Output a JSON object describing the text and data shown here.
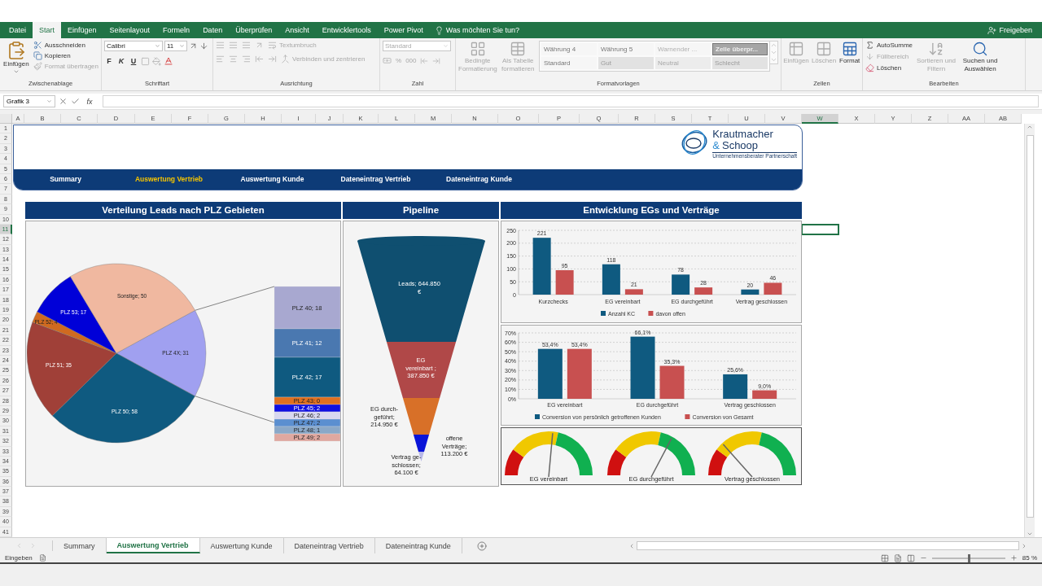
{
  "ribbon_tabs": [
    {
      "label": "Datei",
      "selected": false
    },
    {
      "label": "Start",
      "selected": true
    },
    {
      "label": "Einfügen",
      "selected": false
    },
    {
      "label": "Seitenlayout",
      "selected": false
    },
    {
      "label": "Formeln",
      "selected": false
    },
    {
      "label": "Daten",
      "selected": false
    },
    {
      "label": "Überprüfen",
      "selected": false
    },
    {
      "label": "Ansicht",
      "selected": false
    },
    {
      "label": "Entwicklertools",
      "selected": false
    },
    {
      "label": "Power Pivot",
      "selected": false
    }
  ],
  "tell_me": {
    "placeholder": "Was möchten Sie tun?"
  },
  "share": "Freigeben",
  "clipboard": {
    "title": "Zwischenablage",
    "paste": "Einfügen",
    "items": [
      {
        "label": "Ausschneiden",
        "disabled": false
      },
      {
        "label": "Kopieren",
        "disabled": false
      },
      {
        "label": "Format übertragen",
        "disabled": true
      }
    ]
  },
  "font": {
    "title": "Schriftart",
    "family": "Calibri",
    "size": "11",
    "bold": "F",
    "italic": "K",
    "underline": "U"
  },
  "alignment": {
    "title": "Ausrichtung",
    "wrap": "Textumbruch",
    "merge": "Verbinden und zentrieren"
  },
  "number": {
    "title": "Zahl",
    "format": "Standard",
    "percent": "%",
    "thousands": "000"
  },
  "styles": {
    "title": "Formatvorlagen",
    "conditional": "Bedingte Formatierung",
    "as_table": "Als Tabelle formatieren",
    "cells": [
      {
        "label": "Währung 4",
        "kind": "plain"
      },
      {
        "label": "Währung 5",
        "kind": "plain"
      },
      {
        "label": "Warnender ...",
        "kind": "warning"
      },
      {
        "label": "Zelle überpr...",
        "kind": "check"
      },
      {
        "label": "Standard",
        "kind": "plain"
      },
      {
        "label": "Gut",
        "kind": "good"
      },
      {
        "label": "Neutral",
        "kind": "neutral"
      },
      {
        "label": "Schlecht",
        "kind": "bad"
      }
    ]
  },
  "cells_group": {
    "title": "Zellen",
    "items": [
      {
        "label": "Einfügen",
        "disabled": true
      },
      {
        "label": "Löschen",
        "disabled": true
      },
      {
        "label": "Format",
        "disabled": false
      }
    ]
  },
  "editing": {
    "title": "Bearbeiten",
    "items": [
      {
        "label": "AutoSumme",
        "disabled": false
      },
      {
        "label": "Füllbereich",
        "disabled": true
      },
      {
        "label": "Löschen",
        "disabled": false
      }
    ],
    "sort": {
      "label": "Sortieren und Filtern",
      "disabled": true
    },
    "find": {
      "label": "Suchen und Auswählen",
      "disabled": false
    }
  },
  "formula_bar": {
    "name_box": "Grafik 3",
    "function_label": "fx"
  },
  "columns": [
    {
      "label": "A",
      "selected": false
    },
    {
      "label": "B",
      "selected": false
    },
    {
      "label": "C",
      "selected": false
    },
    {
      "label": "D",
      "selected": false
    },
    {
      "label": "E",
      "selected": false
    },
    {
      "label": "F",
      "selected": false
    },
    {
      "label": "G",
      "selected": false
    },
    {
      "label": "H",
      "selected": false
    },
    {
      "label": "I",
      "selected": false
    },
    {
      "label": "J",
      "selected": false
    },
    {
      "label": "K",
      "selected": false
    },
    {
      "label": "L",
      "selected": false
    },
    {
      "label": "M",
      "selected": false
    },
    {
      "label": "N",
      "selected": false
    },
    {
      "label": "O",
      "selected": false
    },
    {
      "label": "P",
      "selected": false
    },
    {
      "label": "Q",
      "selected": false
    },
    {
      "label": "R",
      "selected": false
    },
    {
      "label": "S",
      "selected": false
    },
    {
      "label": "T",
      "selected": false
    },
    {
      "label": "U",
      "selected": false
    },
    {
      "label": "V",
      "selected": false
    },
    {
      "label": "W",
      "selected": true
    },
    {
      "label": "X",
      "selected": false
    },
    {
      "label": "Y",
      "selected": false
    },
    {
      "label": "Z",
      "selected": false
    },
    {
      "label": "AA",
      "selected": false
    },
    {
      "label": "AB",
      "selected": false
    }
  ],
  "rows": [
    {
      "label": "1",
      "selected": false
    },
    {
      "label": "2",
      "selected": false
    },
    {
      "label": "3",
      "selected": false
    },
    {
      "label": "4",
      "selected": false
    },
    {
      "label": "5",
      "selected": false
    },
    {
      "label": "6",
      "selected": false
    },
    {
      "label": "7",
      "selected": false
    },
    {
      "label": "8",
      "selected": false
    },
    {
      "label": "9",
      "selected": false
    },
    {
      "label": "10",
      "selected": false
    },
    {
      "label": "11",
      "selected": true
    },
    {
      "label": "12",
      "selected": false
    },
    {
      "label": "13",
      "selected": false
    },
    {
      "label": "14",
      "selected": false
    },
    {
      "label": "15",
      "selected": false
    },
    {
      "label": "16",
      "selected": false
    },
    {
      "label": "17",
      "selected": false
    },
    {
      "label": "18",
      "selected": false
    },
    {
      "label": "19",
      "selected": false
    },
    {
      "label": "20",
      "selected": false
    },
    {
      "label": "21",
      "selected": false
    },
    {
      "label": "22",
      "selected": false
    },
    {
      "label": "23",
      "selected": false
    },
    {
      "label": "24",
      "selected": false
    },
    {
      "label": "25",
      "selected": false
    },
    {
      "label": "26",
      "selected": false
    },
    {
      "label": "27",
      "selected": false
    },
    {
      "label": "28",
      "selected": false
    },
    {
      "label": "29",
      "selected": false
    },
    {
      "label": "30",
      "selected": false
    },
    {
      "label": "31",
      "selected": false
    },
    {
      "label": "32",
      "selected": false
    },
    {
      "label": "33",
      "selected": false
    },
    {
      "label": "34",
      "selected": false
    },
    {
      "label": "35",
      "selected": false
    },
    {
      "label": "36",
      "selected": false
    },
    {
      "label": "37",
      "selected": false
    },
    {
      "label": "38",
      "selected": false
    },
    {
      "label": "39",
      "selected": false
    },
    {
      "label": "40",
      "selected": false
    },
    {
      "label": "41",
      "selected": false
    }
  ],
  "dashboard": {
    "logo": {
      "name": "Krautmacher",
      "ampersand": "&",
      "name_2": "Schoop",
      "tagline": "Unternehmensberater Partnerschaft"
    },
    "nav": [
      {
        "label": "Summary",
        "selected": false
      },
      {
        "label": "Auswertung Vertrieb",
        "selected": true
      },
      {
        "label": "Auswertung Kunde",
        "selected": false
      },
      {
        "label": "Dateneintrag Vertrieb",
        "selected": false
      },
      {
        "label": "Dateneintrag Kunde",
        "selected": false
      }
    ]
  },
  "leads_panel": {
    "title": "Verteilung Leads nach PLZ Gebieten",
    "chart_data": {
      "type": "pie",
      "categories": [
        "PLZ 4X; 31",
        "PLZ 50; 58",
        "PLZ 51; 35",
        "PLZ 52; 4",
        "PLZ 53; 17",
        "Sonstige; 50"
      ],
      "values": [
        31,
        58,
        35,
        4,
        17,
        50
      ],
      "colors": [
        "#a0a0f0",
        "#0f5a80",
        "#a04038",
        "#d06a20",
        "#0000d8",
        "#f0b8a0"
      ]
    },
    "breakdown": [
      {
        "label": "PLZ 40; 18",
        "color": "#a8a8d0"
      },
      {
        "label": "PLZ 41; 12",
        "color": "#4a78b0"
      },
      {
        "label": "PLZ 42; 17",
        "color": "#0f5a80"
      },
      {
        "label": "PLZ 43; 0",
        "color": "#e07020"
      },
      {
        "label": "PLZ 45; 2",
        "color": "#1010e0"
      },
      {
        "label": "PLZ 46; 2",
        "color": "#d8d8f0"
      },
      {
        "label": "PLZ 47; 2",
        "color": "#5b8fd0"
      },
      {
        "label": "PLZ 48; 1",
        "color": "#8aa8c8"
      },
      {
        "label": "PLZ 49; 2",
        "color": "#e0a8a0"
      }
    ]
  },
  "pipeline_panel": {
    "title": "Pipeline",
    "segments": [
      {
        "label": "Leads; 644.850 €",
        "color": "#0f4f70"
      },
      {
        "label": "EG vereinbart ; 387.850 €",
        "color": "#b04848"
      },
      {
        "label": "EG durch-geführt; 214.950 €",
        "color": "#d87028"
      },
      {
        "label": "offene Verträge; 113.200 €",
        "color": "#0a14d8"
      },
      {
        "label": "Vertrag ge-schlossen; 64.100 €",
        "color": "#b8b8e8"
      }
    ]
  },
  "development_panel": {
    "title": "Entwicklung EGs und Verträge",
    "counts": {
      "chart_data": {
        "type": "bar",
        "categories": [
          "Kurzchecks",
          "EG vereinbart",
          "EG durchgeführt",
          "Vertrag geschlossen"
        ],
        "ylim": [
          0,
          250
        ],
        "yticks": [
          0,
          50,
          100,
          150,
          200,
          250
        ],
        "data_labels": true,
        "grid": true,
        "legend": true,
        "series": [
          {
            "name": "Anzahl KC",
            "color": "#0f5a80",
            "values": [
              221,
              118,
              78,
              20
            ]
          },
          {
            "name": "davon offen",
            "color": "#c85050",
            "values": [
              95,
              21,
              28,
              46
            ]
          }
        ]
      }
    },
    "conversion": {
      "chart_data": {
        "type": "bar",
        "categories": [
          "EG vereinbart",
          "EG durchgeführt",
          "Vertrag geschlossen"
        ],
        "ylim": [
          0,
          70
        ],
        "yticks": [
          {
            "value": 0,
            "label": "0%"
          },
          {
            "value": 10,
            "label": "10%"
          },
          {
            "value": 20,
            "label": "20%"
          },
          {
            "value": 30,
            "label": "30%"
          },
          {
            "value": 40,
            "label": "40%"
          },
          {
            "value": 50,
            "label": "50%"
          },
          {
            "value": 60,
            "label": "60%"
          },
          {
            "value": 70,
            "label": "70%"
          }
        ],
        "grid": true,
        "legend": true,
        "value_labels": [
          [
            "53,4%",
            "66,1%",
            "25,6%"
          ],
          [
            "53,4%",
            "35,3%",
            "9,0%"
          ]
        ],
        "series": [
          {
            "name": "Conversion von persönlich getroffenen Kunden",
            "color": "#0f5a80",
            "values": [
              53,
              66,
              26
            ]
          },
          {
            "name": "Conversion von Gesamt",
            "color": "#c85050",
            "values": [
              53,
              35,
              9
            ]
          }
        ]
      }
    },
    "gauges": [
      {
        "label": "EG vereinbart",
        "level": 0.53
      },
      {
        "label": "EG durchgeführt",
        "level": 0.66
      },
      {
        "label": "Vertrag geschlossen",
        "level": 0.26
      }
    ]
  },
  "sheet_tabs": [
    {
      "label": "Summary",
      "selected": false
    },
    {
      "label": "Auswertung Vertrieb",
      "selected": true
    },
    {
      "label": "Auswertung Kunde",
      "selected": false
    },
    {
      "label": "Dateneintrag Vertrieb",
      "selected": false
    },
    {
      "label": "Dateneintrag Kunde",
      "selected": false
    }
  ],
  "status_bar": {
    "mode": "Eingeben",
    "zoom": {
      "reading": "85 %",
      "level": 0.5
    }
  }
}
